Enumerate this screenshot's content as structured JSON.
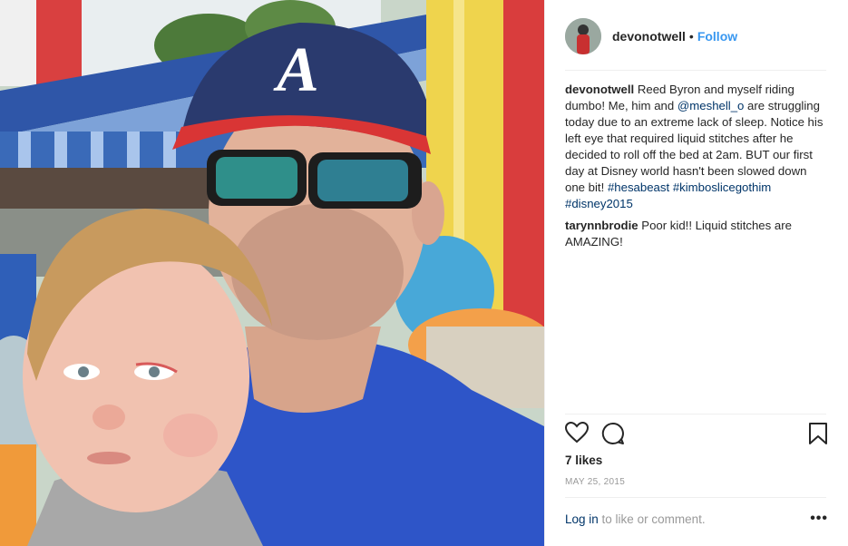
{
  "post": {
    "username": "devonotwell",
    "dot": "•",
    "follow_label": "Follow"
  },
  "comments": [
    {
      "user": "devonotwell",
      "segments": [
        {
          "text": " Reed Byron and myself riding dumbo! Me, him and ",
          "link": false
        },
        {
          "text": "@meshell_o",
          "link": true
        },
        {
          "text": " are struggling today due to an extreme lack of sleep. Notice his left eye that required liquid stitches after he decided to roll off the bed at 2am. BUT our first day at Disney world hasn't been slowed down one bit! ",
          "link": false
        },
        {
          "text": "#hesabeast",
          "link": true
        },
        {
          "text": " ",
          "link": false
        },
        {
          "text": "#kimboslicegothim",
          "link": true
        },
        {
          "text": " ",
          "link": false
        },
        {
          "text": "#disney2015",
          "link": true
        }
      ]
    },
    {
      "user": "tarynnbrodie",
      "segments": [
        {
          "text": " Poor kid!! Liquid stitches are AMAZING!",
          "link": false
        }
      ]
    }
  ],
  "actions": {
    "like_icon": "heart-icon",
    "comment_icon": "comment-bubble-icon",
    "save_icon": "bookmark-icon"
  },
  "likes": "7 likes",
  "date": "MAY 25, 2015",
  "footer": {
    "login_label": "Log in",
    "rest_text": " to like or comment.",
    "more_label": "•••"
  },
  "colors": {
    "link": "#003569",
    "follow": "#3897f0",
    "muted": "#999999"
  }
}
